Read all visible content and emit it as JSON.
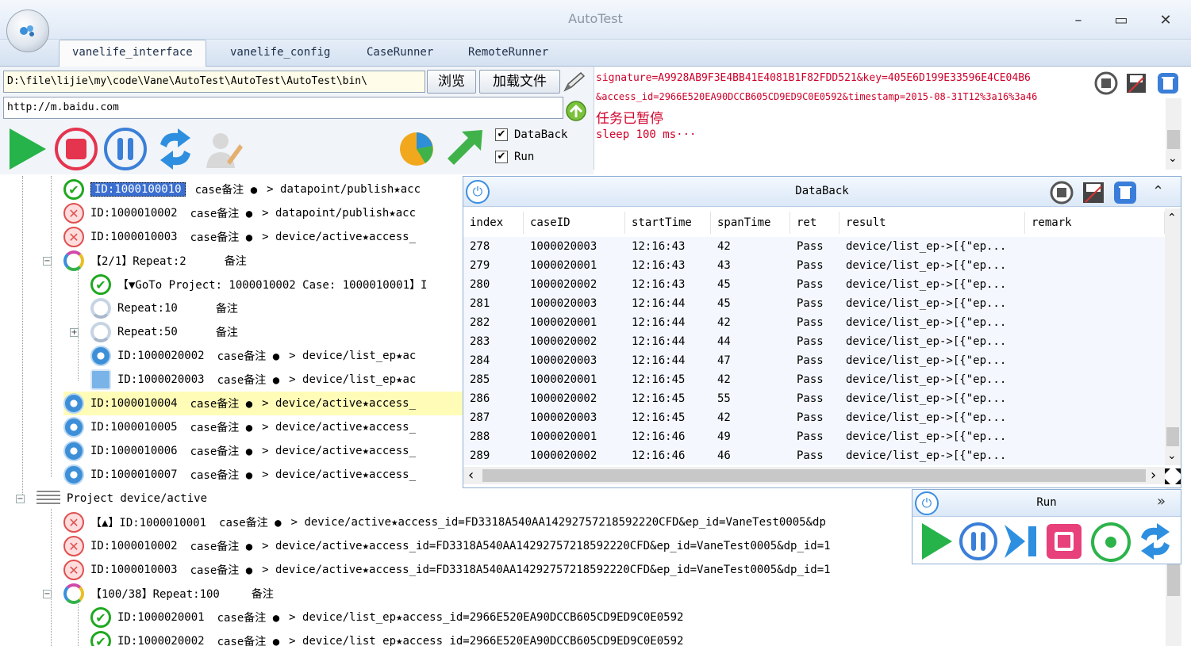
{
  "window": {
    "title": "AutoTest",
    "minimize": "–",
    "maximize": "▭",
    "close": "✕"
  },
  "tabs": [
    {
      "label": "vanelife_interface"
    },
    {
      "label": "vanelife_config"
    },
    {
      "label": "CaseRunner"
    },
    {
      "label": "RemoteRunner"
    }
  ],
  "toolbar": {
    "path_value": "D:\\file\\lijie\\my\\code\\Vane\\AutoTest\\AutoTest\\AutoTest\\bin\\",
    "browse_label": "浏览",
    "load_label": "加载文件",
    "url_value": "http://m.baidu.com",
    "databack_label": "DataBack",
    "run_label": "Run",
    "checkmark": "✔"
  },
  "log": {
    "line1": "signature=A9928AB9F3E4BB41E4081B1F82FDD521&key=405E6D199E33596E4CE04B6",
    "line2": "&access_id=2966E520EA90DCCB605CD9ED9C0E0592&timestamp=2015-08-31T12%3a16%3a46",
    "line3": "任务已暂停",
    "line4": "sleep 100 ms···"
  },
  "tree": {
    "r1": {
      "id": "ID:1000100010",
      "note": "case备注 ●",
      "path": "> datapoint/publish★acc"
    },
    "r2": {
      "id": "ID:1000010002",
      "note": "case备注 ●",
      "path": "> datapoint/publish★acc"
    },
    "r3": {
      "id": "ID:1000010003",
      "note": "case备注 ●",
      "path": "> device/active★access_"
    },
    "r4": {
      "label": "【2/1】Repeat:2",
      "note": "备注"
    },
    "r5": {
      "label": "【▼GoTo Project: 1000010002 Case: 1000010001】I"
    },
    "r6": {
      "label": "Repeat:10",
      "note": "备注"
    },
    "r7": {
      "label": "Repeat:50",
      "note": "备注"
    },
    "r8": {
      "id": "ID:1000020002",
      "note": "case备注 ●",
      "path": "> device/list_ep★ac"
    },
    "r9": {
      "id": "ID:1000020003",
      "note": "case备注 ●",
      "path": "> device/list_ep★ac"
    },
    "r10": {
      "id": "ID:1000010004",
      "note": "case备注 ●",
      "path": "> device/active★access_"
    },
    "r11": {
      "id": "ID:1000010005",
      "note": "case备注 ●",
      "path": "> device/active★access_"
    },
    "r12": {
      "id": "ID:1000010006",
      "note": "case备注 ●",
      "path": "> device/active★access_"
    },
    "r13": {
      "id": "ID:1000010007",
      "note": "case备注 ●",
      "path": "> device/active★access_"
    },
    "r14": {
      "label": "Project device/active"
    },
    "r15": {
      "id": "【▲】ID:1000010001",
      "note": "case备注 ●",
      "path": "> device/active★access_id=FD3318A540AA14292757218592220CFD&ep_id=VaneTest0005&dp"
    },
    "r16": {
      "id": "ID:1000010002",
      "note": "case备注 ●",
      "path": "> device/active★access_id=FD3318A540AA14292757218592220CFD&ep_id=VaneTest0005&dp_id=1"
    },
    "r17": {
      "id": "ID:1000010003",
      "note": "case备注 ●",
      "path": "> device/active★access_id=FD3318A540AA14292757218592220CFD&ep_id=VaneTest0005&dp_id=1"
    },
    "r18": {
      "label": "【100/38】Repeat:100",
      "note": "备注"
    },
    "r19": {
      "id": "ID:1000020001",
      "note": "case备注 ●",
      "path": "> device/list_ep★access_id=2966E520EA90DCCB605CD9ED9C0E0592"
    },
    "r20": {
      "id": "ID:1000020002",
      "note": "case备注 ●",
      "path": "> device/list_ep★access_id=2966E520EA90DCCB605CD9ED9C0E0592"
    }
  },
  "databack": {
    "title": "DataBack",
    "columns": [
      "index",
      "caseID",
      "startTime",
      "spanTime",
      "ret",
      "result",
      "remark"
    ],
    "rows": [
      [
        "278",
        "1000020003",
        "12:16:43",
        "42",
        "Pass",
        "device/list_ep->[{\"ep...",
        ""
      ],
      [
        "279",
        "1000020001",
        "12:16:43",
        "43",
        "Pass",
        "device/list_ep->[{\"ep...",
        ""
      ],
      [
        "280",
        "1000020002",
        "12:16:43",
        "45",
        "Pass",
        "device/list_ep->[{\"ep...",
        ""
      ],
      [
        "281",
        "1000020003",
        "12:16:44",
        "45",
        "Pass",
        "device/list_ep->[{\"ep...",
        ""
      ],
      [
        "282",
        "1000020001",
        "12:16:44",
        "42",
        "Pass",
        "device/list_ep->[{\"ep...",
        ""
      ],
      [
        "283",
        "1000020002",
        "12:16:44",
        "44",
        "Pass",
        "device/list_ep->[{\"ep...",
        ""
      ],
      [
        "284",
        "1000020003",
        "12:16:44",
        "47",
        "Pass",
        "device/list_ep->[{\"ep...",
        ""
      ],
      [
        "285",
        "1000020001",
        "12:16:45",
        "42",
        "Pass",
        "device/list_ep->[{\"ep...",
        ""
      ],
      [
        "286",
        "1000020002",
        "12:16:45",
        "55",
        "Pass",
        "device/list_ep->[{\"ep...",
        ""
      ],
      [
        "287",
        "1000020003",
        "12:16:45",
        "42",
        "Pass",
        "device/list_ep->[{\"ep...",
        ""
      ],
      [
        "288",
        "1000020001",
        "12:16:46",
        "49",
        "Pass",
        "device/list_ep->[{\"ep...",
        ""
      ],
      [
        "289",
        "1000020002",
        "12:16:46",
        "46",
        "Pass",
        "device/list_ep->[{\"ep...",
        ""
      ]
    ]
  },
  "runpanel": {
    "title": "Run"
  },
  "glyphs": {
    "ok": "✔",
    "err": "✕",
    "plus": "+",
    "minus": "−",
    "collapse": "⌃",
    "expand": "»",
    "left": "‹",
    "right": "›",
    "up": "⌃",
    "down": "⌄"
  },
  "colors": {
    "log_text": "#d0002a",
    "accent_blue": "#3b8ee0",
    "pass_green": "#1fa81f",
    "fail_red": "#e05050",
    "stop_red": "#e5344e",
    "highlight": "#fffcb8"
  }
}
